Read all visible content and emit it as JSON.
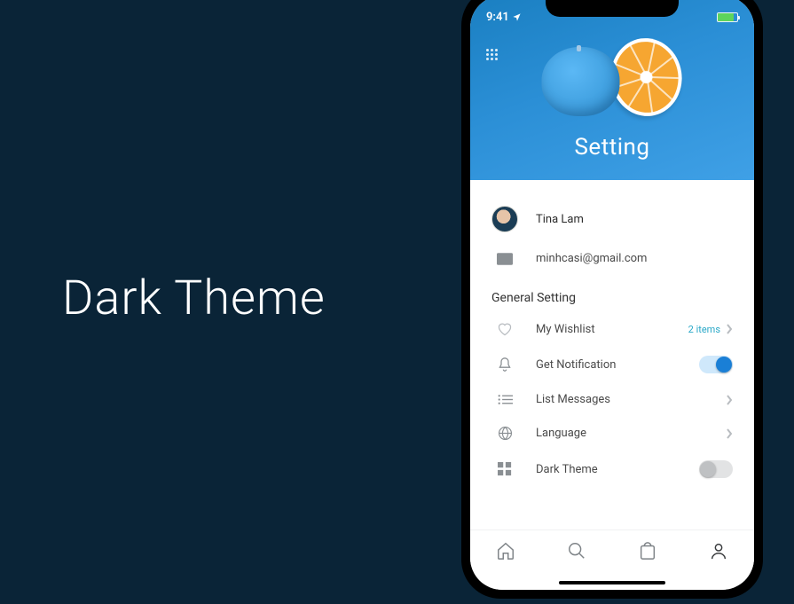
{
  "left_headline": "Dark Theme",
  "status": {
    "time": "9:41"
  },
  "header": {
    "title": "Setting"
  },
  "profile": {
    "name": "Tina Lam",
    "email": "minhcasi@gmail.com"
  },
  "section_label": "General Setting",
  "rows": {
    "wishlist": {
      "label": "My Wishlist",
      "count": "2 items"
    },
    "notification": {
      "label": "Get Notification"
    },
    "messages": {
      "label": "List Messages"
    },
    "language": {
      "label": "Language"
    },
    "dark_theme": {
      "label": "Dark Theme"
    }
  }
}
